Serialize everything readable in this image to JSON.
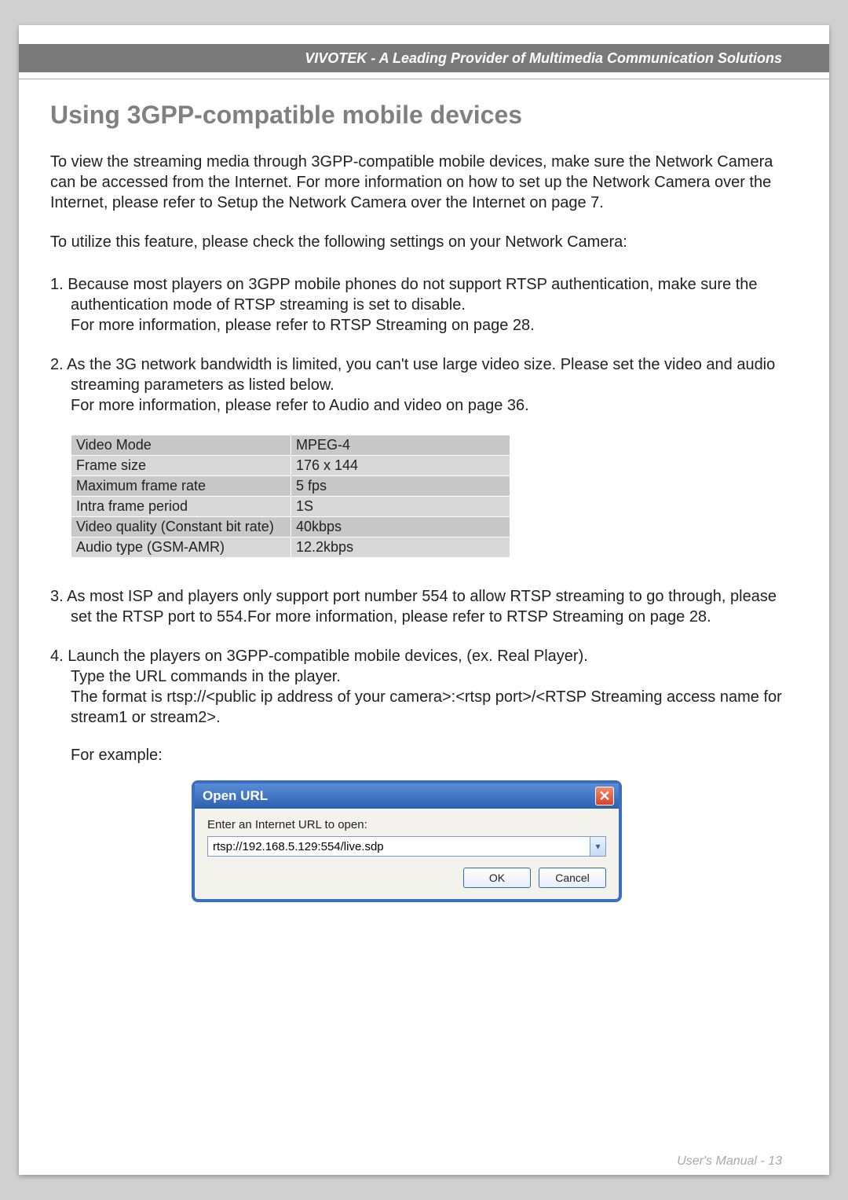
{
  "header": {
    "brand_tagline": "VIVOTEK - A Leading Provider of Multimedia Communication Solutions"
  },
  "title": "Using 3GPP-compatible mobile devices",
  "intro1": "To view the streaming media through 3GPP-compatible mobile devices, make sure the Network Camera can be accessed from the Internet. For more information on how to set up the Network Camera over the Internet, please refer to Setup the Network Camera over the Internet on page 7.",
  "intro2": "To utilize this feature, please check the following settings on your Network Camera:",
  "item1_a": "1. Because most players on 3GPP mobile phones do not support RTSP authentication, make sure the authentication mode of RTSP streaming is set to disable.",
  "item1_b": "For more information, please refer to RTSP Streaming on page 28.",
  "item2_a": "2. As the 3G network bandwidth is limited, you can't use large video size. Please set the video and audio streaming parameters as listed below.",
  "item2_b": "For more information, please refer to Audio and video on page 36.",
  "table": {
    "rows": [
      {
        "label": "Video Mode",
        "value": "MPEG-4"
      },
      {
        "label": "Frame size",
        "value": "176 x 144"
      },
      {
        "label": "Maximum frame rate",
        "value": "5 fps"
      },
      {
        "label": "Intra frame period",
        "value": "1S"
      },
      {
        "label": "Video quality (Constant bit rate)",
        "value": "40kbps"
      },
      {
        "label": "Audio type (GSM-AMR)",
        "value": "12.2kbps"
      }
    ]
  },
  "item3": "3. As most ISP and players only support port number 554 to allow RTSP streaming to go through, please set the RTSP port to 554.For more information, please refer to RTSP Streaming on page 28.",
  "item4_a": "4. Launch the players on 3GPP-compatible mobile devices, (ex. Real Player).",
  "item4_b": "Type the URL commands in the player.",
  "item4_c": "The format is rtsp://<public ip address of your camera>:<rtsp port>/<RTSP Streaming access name for stream1 or stream2>.",
  "for_example": "For example:",
  "dialog": {
    "title": "Open URL",
    "label": "Enter an Internet URL to open:",
    "value": "rtsp://192.168.5.129:554/live.sdp",
    "ok": "OK",
    "cancel": "Cancel"
  },
  "footer": "User's Manual - 13"
}
